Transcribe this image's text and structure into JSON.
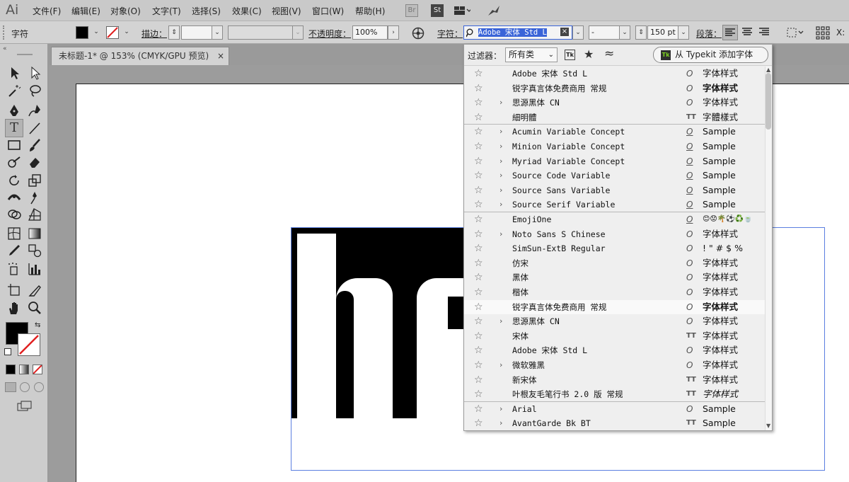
{
  "app": {
    "logo": "Ai"
  },
  "menu": [
    "文件(F)",
    "编辑(E)",
    "对象(O)",
    "文字(T)",
    "选择(S)",
    "效果(C)",
    "视图(V)",
    "窗口(W)",
    "帮助(H)"
  ],
  "menu_buttons": {
    "bridge": "Br",
    "stock": "St"
  },
  "control_bar": {
    "panel_label": "字符",
    "stroke_label": "描边：",
    "opacity_label": "不透明度：",
    "opacity_value": "100%",
    "char_label": "字符：",
    "font_search_value": "Adobe 宋体 Std L",
    "font_style_value": "-",
    "font_size_value": "150 pt",
    "paragraph_label": "段落：",
    "x_label": "X:"
  },
  "document_tab": {
    "title": "未标题-1* @ 153% (CMYK/GPU 预览)",
    "close": "×"
  },
  "font_panel": {
    "filter_label": "过滤器：",
    "filter_value": "所有类",
    "typekit_button": "从 Typekit 添加字体",
    "fonts": [
      {
        "name": "Adobe 宋体 Std L",
        "expand": false,
        "type": "O",
        "sample": "字体样式"
      },
      {
        "name": "锐字真言体免费商用 常规",
        "expand": false,
        "type": "O",
        "sample": "字体样式"
      },
      {
        "name": "思源黑体 CN",
        "expand": true,
        "type": "O",
        "sample": "字体样式"
      },
      {
        "name": "細明體",
        "expand": false,
        "type": "TT",
        "sample": "字體樣式"
      },
      {
        "name": "Acumin Variable Concept",
        "expand": true,
        "type": "var",
        "sample": "Sample"
      },
      {
        "name": "Minion Variable Concept",
        "expand": true,
        "type": "var",
        "sample": "Sample"
      },
      {
        "name": "Myriad Variable Concept",
        "expand": true,
        "type": "var",
        "sample": "Sample"
      },
      {
        "name": "Source Code Variable",
        "expand": true,
        "type": "var",
        "sample": "Sample"
      },
      {
        "name": "Source Sans Variable",
        "expand": true,
        "type": "var",
        "sample": "Sample"
      },
      {
        "name": "Source Serif Variable",
        "expand": true,
        "type": "var",
        "sample": "Sample"
      },
      {
        "name": "EmojiOne",
        "expand": false,
        "type": "svg",
        "sample": "😊😟🌴⚽♻️🍵"
      },
      {
        "name": "Noto Sans S Chinese",
        "expand": true,
        "type": "O",
        "sample": "字体样式"
      },
      {
        "name": "SimSun-ExtB Regular",
        "expand": false,
        "type": "O",
        "sample": "! \" # $ %"
      },
      {
        "name": "仿宋",
        "expand": false,
        "type": "O",
        "sample": "字体样式"
      },
      {
        "name": "黑体",
        "expand": false,
        "type": "O",
        "sample": "字体样式"
      },
      {
        "name": "楷体",
        "expand": false,
        "type": "O",
        "sample": "字体样式"
      },
      {
        "name": "锐字真言体免费商用 常规",
        "expand": false,
        "type": "O",
        "sample": "字体样式"
      },
      {
        "name": "思源黑体 CN",
        "expand": true,
        "type": "O",
        "sample": "字体样式"
      },
      {
        "name": "宋体",
        "expand": false,
        "type": "TT",
        "sample": "字体样式"
      },
      {
        "name": "Adobe 宋体 Std L",
        "expand": false,
        "type": "O",
        "sample": "字体样式"
      },
      {
        "name": "微软雅黑",
        "expand": true,
        "type": "O",
        "sample": "字体样式"
      },
      {
        "name": "新宋体",
        "expand": false,
        "type": "TT",
        "sample": "字体样式"
      },
      {
        "name": "叶根友毛笔行书 2.0 版 常规",
        "expand": false,
        "type": "TT",
        "sample": "字体样式"
      },
      {
        "name": "Arial",
        "expand": true,
        "type": "O",
        "sample": "Sample"
      },
      {
        "name": "AvantGarde Bk BT",
        "expand": true,
        "type": "TT",
        "sample": "Sample"
      }
    ]
  },
  "colors": {
    "accent": "#5b7fe0",
    "selection": "#3a64d8"
  }
}
